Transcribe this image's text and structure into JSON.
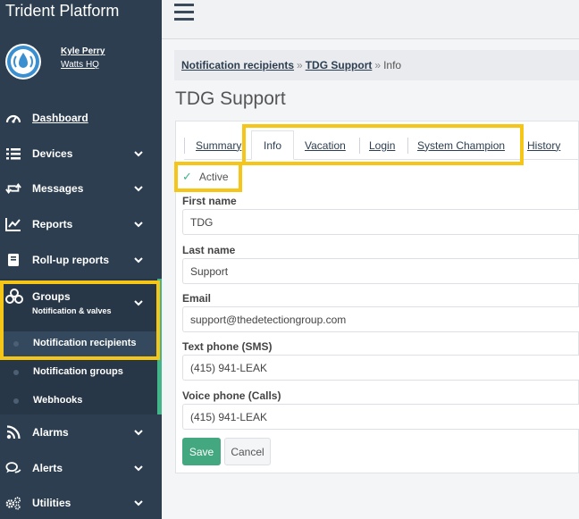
{
  "app": {
    "title": "Trident Platform"
  },
  "user": {
    "name": "Kyle Perry",
    "org": "Watts HQ"
  },
  "sidebar": {
    "items": [
      {
        "label": "Dashboard",
        "icon": "gauge-icon"
      },
      {
        "label": "Devices",
        "icon": "list-icon"
      },
      {
        "label": "Messages",
        "icon": "retweet-icon"
      },
      {
        "label": "Reports",
        "icon": "chart-line-icon"
      },
      {
        "label": "Roll-up reports",
        "icon": "book-icon"
      },
      {
        "label": "Groups",
        "sublabel": "Notification & valves",
        "icon": "groups-icon"
      },
      {
        "label": "Alarms",
        "icon": "rss-icon"
      },
      {
        "label": "Alerts",
        "icon": "chat-icon"
      },
      {
        "label": "Utilities",
        "icon": "cogs-icon"
      }
    ],
    "groups_children": [
      {
        "label": "Notification recipients"
      },
      {
        "label": "Notification groups"
      },
      {
        "label": "Webhooks"
      }
    ]
  },
  "breadcrumb": {
    "first": "Notification recipients",
    "second": "TDG Support",
    "current": "Info",
    "separator": "»"
  },
  "page": {
    "title": "TDG Support"
  },
  "tabs": [
    {
      "label": "Summary"
    },
    {
      "label": "Info"
    },
    {
      "label": "Vacation"
    },
    {
      "label": "Login"
    },
    {
      "label": "System Champion"
    },
    {
      "label": "History"
    }
  ],
  "form": {
    "active_label": "Active",
    "active_check": "✓",
    "first_name": {
      "label": "First name",
      "value": "TDG"
    },
    "last_name": {
      "label": "Last name",
      "value": "Support"
    },
    "email": {
      "label": "Email",
      "value": "support@thedetectiongroup.com"
    },
    "text_phone": {
      "label": "Text phone (SMS)",
      "value": "(415) 941-LEAK"
    },
    "voice_phone": {
      "label": "Voice phone (Calls)",
      "value": "(415) 941-LEAK"
    },
    "save_label": "Save",
    "cancel_label": "Cancel"
  },
  "colors": {
    "sidebar": "#2c3e50",
    "accent": "#43b58a",
    "highlight": "#f5c518",
    "save": "#43a87f"
  }
}
